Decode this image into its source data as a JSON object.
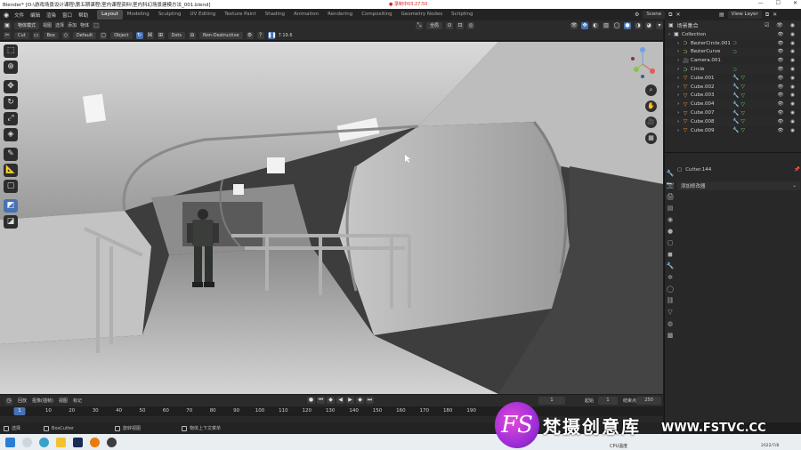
{
  "window": {
    "title": "Blender* [D:\\游戏场景设计课程\\第五期课程\\室内课程资料\\室内科幻场景建模方法_001.blend]",
    "recording": "● 录制中03:27:50"
  },
  "topbar": {
    "menu": [
      "文件",
      "编辑",
      "渲染",
      "窗口",
      "帮助"
    ],
    "workspaces": [
      "Layout",
      "Modeling",
      "Sculpting",
      "UV Editing",
      "Texture Paint",
      "Shading",
      "Animation",
      "Rendering",
      "Compositing",
      "Geometry Nodes",
      "Scripting"
    ],
    "active_workspace": "Layout",
    "scene": "Scene",
    "view_layer": "View Layer"
  },
  "header1": {
    "mode": "物体模式",
    "menus": [
      "视图",
      "选择",
      "添加",
      "物体"
    ],
    "orientation": "全局",
    "pivot": "⊙",
    "snap": "⊡"
  },
  "header2": {
    "tool": "Cut",
    "shape": "Box",
    "mode": "Default",
    "object": "Object",
    "dots": "Dots",
    "boolean": "Non-Destructive",
    "version": "7.19.6"
  },
  "outliner": {
    "header_label": "场景集合",
    "items": [
      {
        "name": "Collection",
        "icon": "collection-icon",
        "depth": 0
      },
      {
        "name": "BezierCircle.001",
        "icon": "curve-icon",
        "depth": 1
      },
      {
        "name": "BezierCurve",
        "icon": "curve-icon",
        "depth": 1
      },
      {
        "name": "Camera.001",
        "icon": "camera-icon",
        "depth": 1
      },
      {
        "name": "Circle",
        "icon": "curve-icon",
        "depth": 1
      },
      {
        "name": "Cube.001",
        "icon": "mesh-icon",
        "depth": 1
      },
      {
        "name": "Cube.002",
        "icon": "mesh-icon",
        "depth": 1
      },
      {
        "name": "Cube.003",
        "icon": "mesh-icon",
        "depth": 1
      },
      {
        "name": "Cube.004",
        "icon": "mesh-icon",
        "depth": 1
      },
      {
        "name": "Cube.007",
        "icon": "mesh-icon",
        "depth": 1
      },
      {
        "name": "Cube.008",
        "icon": "mesh-icon",
        "depth": 1
      },
      {
        "name": "Cube.009",
        "icon": "mesh-icon",
        "depth": 1
      }
    ]
  },
  "properties": {
    "object_name": "Cutter.144",
    "add_modifier": "添加修改器"
  },
  "timeline": {
    "menus": [
      "回放",
      "抠像(插帧)",
      "视图",
      "标记"
    ],
    "current_frame": "1",
    "start_label": "起始",
    "start": "1",
    "end_label": "结束点",
    "end": "250",
    "ruler_marks": [
      "1",
      "10",
      "20",
      "30",
      "40",
      "50",
      "60",
      "70",
      "80",
      "90",
      "100",
      "110",
      "120",
      "130",
      "140",
      "150",
      "160",
      "170",
      "180",
      "190"
    ]
  },
  "statusbar": {
    "items": [
      "选择",
      "BoxCutter",
      "旋转视图",
      "物体上下文菜单"
    ]
  },
  "taskbar": {
    "cpu": "CPU温度",
    "date": "2022/7/8"
  },
  "watermark": {
    "logo": "FS",
    "cn": "梵摄创意库",
    "url": "WWW.FSTVC.CC"
  }
}
